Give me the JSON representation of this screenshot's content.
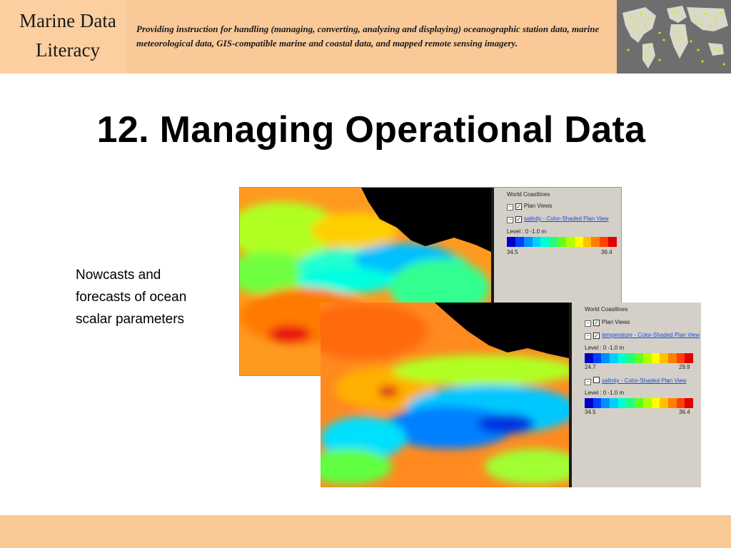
{
  "header": {
    "brand_line1": "Marine Data",
    "brand_line2": "Literacy",
    "tagline": "Providing instruction for handling (managing, converting, analyzing and displaying) oceanographic station data, marine meteorological data, GIS-compatible marine and coastal data, and mapped remote sensing imagery.",
    "globe_icon": "world-map-icon"
  },
  "slide": {
    "title": "12.  Managing Operational Data",
    "body": "Nowcasts and forecasts of ocean scalar parameters"
  },
  "screenshot1": {
    "layer_root": "World Coastlines",
    "plan_views": "Plan Views",
    "layer": "salinity - Color-Shaded Plan View",
    "level": "Level : 0 -1.0 m",
    "min": "34.5",
    "max": "36.4"
  },
  "screenshot2": {
    "layer_root": "World Coastlines",
    "plan_views": "Plan Views",
    "layer1": "temperature - Color-Shaded Plan View",
    "level1": "Level : 0 -1.0 m",
    "min1": "24.7",
    "max1": "29.9",
    "layer2": "salinity - Color-Shaded Plan View",
    "level2": "Level : 0 -1.0 m",
    "min2": "34.5",
    "max2": "36.4"
  },
  "colors": {
    "banner": "#fac998",
    "colorbar": [
      "#0000c8",
      "#0040ff",
      "#0090ff",
      "#00d0ff",
      "#00ffd0",
      "#20ff80",
      "#60ff20",
      "#b0ff00",
      "#ffff00",
      "#ffc000",
      "#ff8000",
      "#ff4000",
      "#e00000"
    ]
  }
}
